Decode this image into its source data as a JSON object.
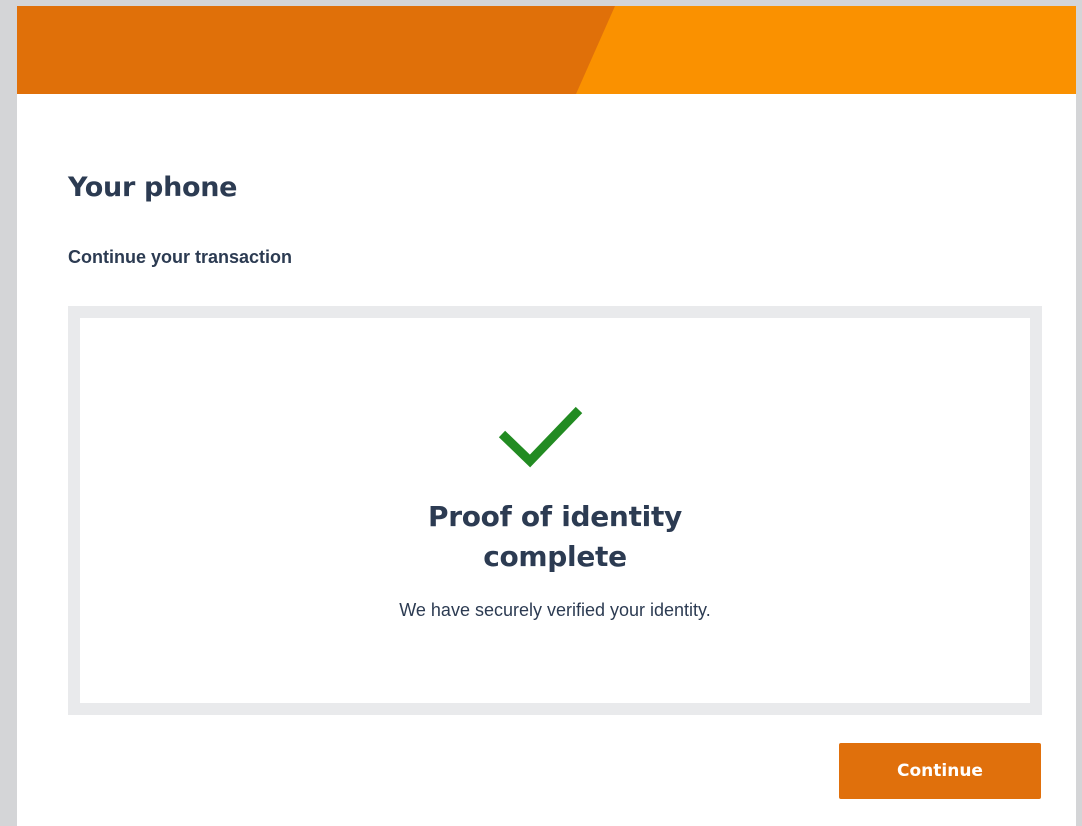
{
  "header": {
    "colors": {
      "left_band": "#e07009",
      "right_band": "#fa9100"
    }
  },
  "page": {
    "title": "Your phone",
    "subtitle": "Continue your transaction"
  },
  "status": {
    "icon": "checkmark-icon",
    "icon_color": "#228b22",
    "title_line1": "Proof of identity",
    "title_line2": "complete",
    "message": "We have securely verified your identity."
  },
  "actions": {
    "continue_label": "Continue",
    "continue_color": "#e0700c"
  }
}
